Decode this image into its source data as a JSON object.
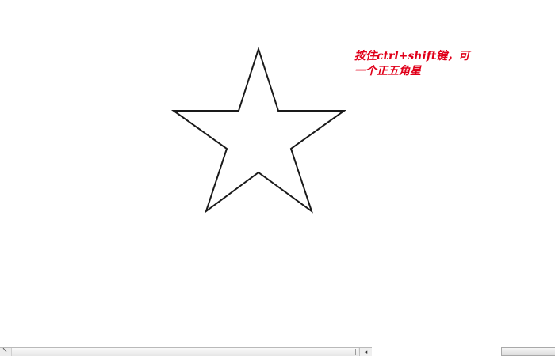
{
  "annotation": {
    "line1": "按住ctrl+shift键，可",
    "line2": "一个正五角星",
    "color": "#e0001a"
  },
  "shape": {
    "type": "five-pointed star",
    "stroke_color": "#1a1a1a",
    "fill_color": "#ffffff"
  },
  "icons": {
    "scroll_left": "scroll-left-arrow-icon",
    "page_corner": "page-corner-icon"
  }
}
